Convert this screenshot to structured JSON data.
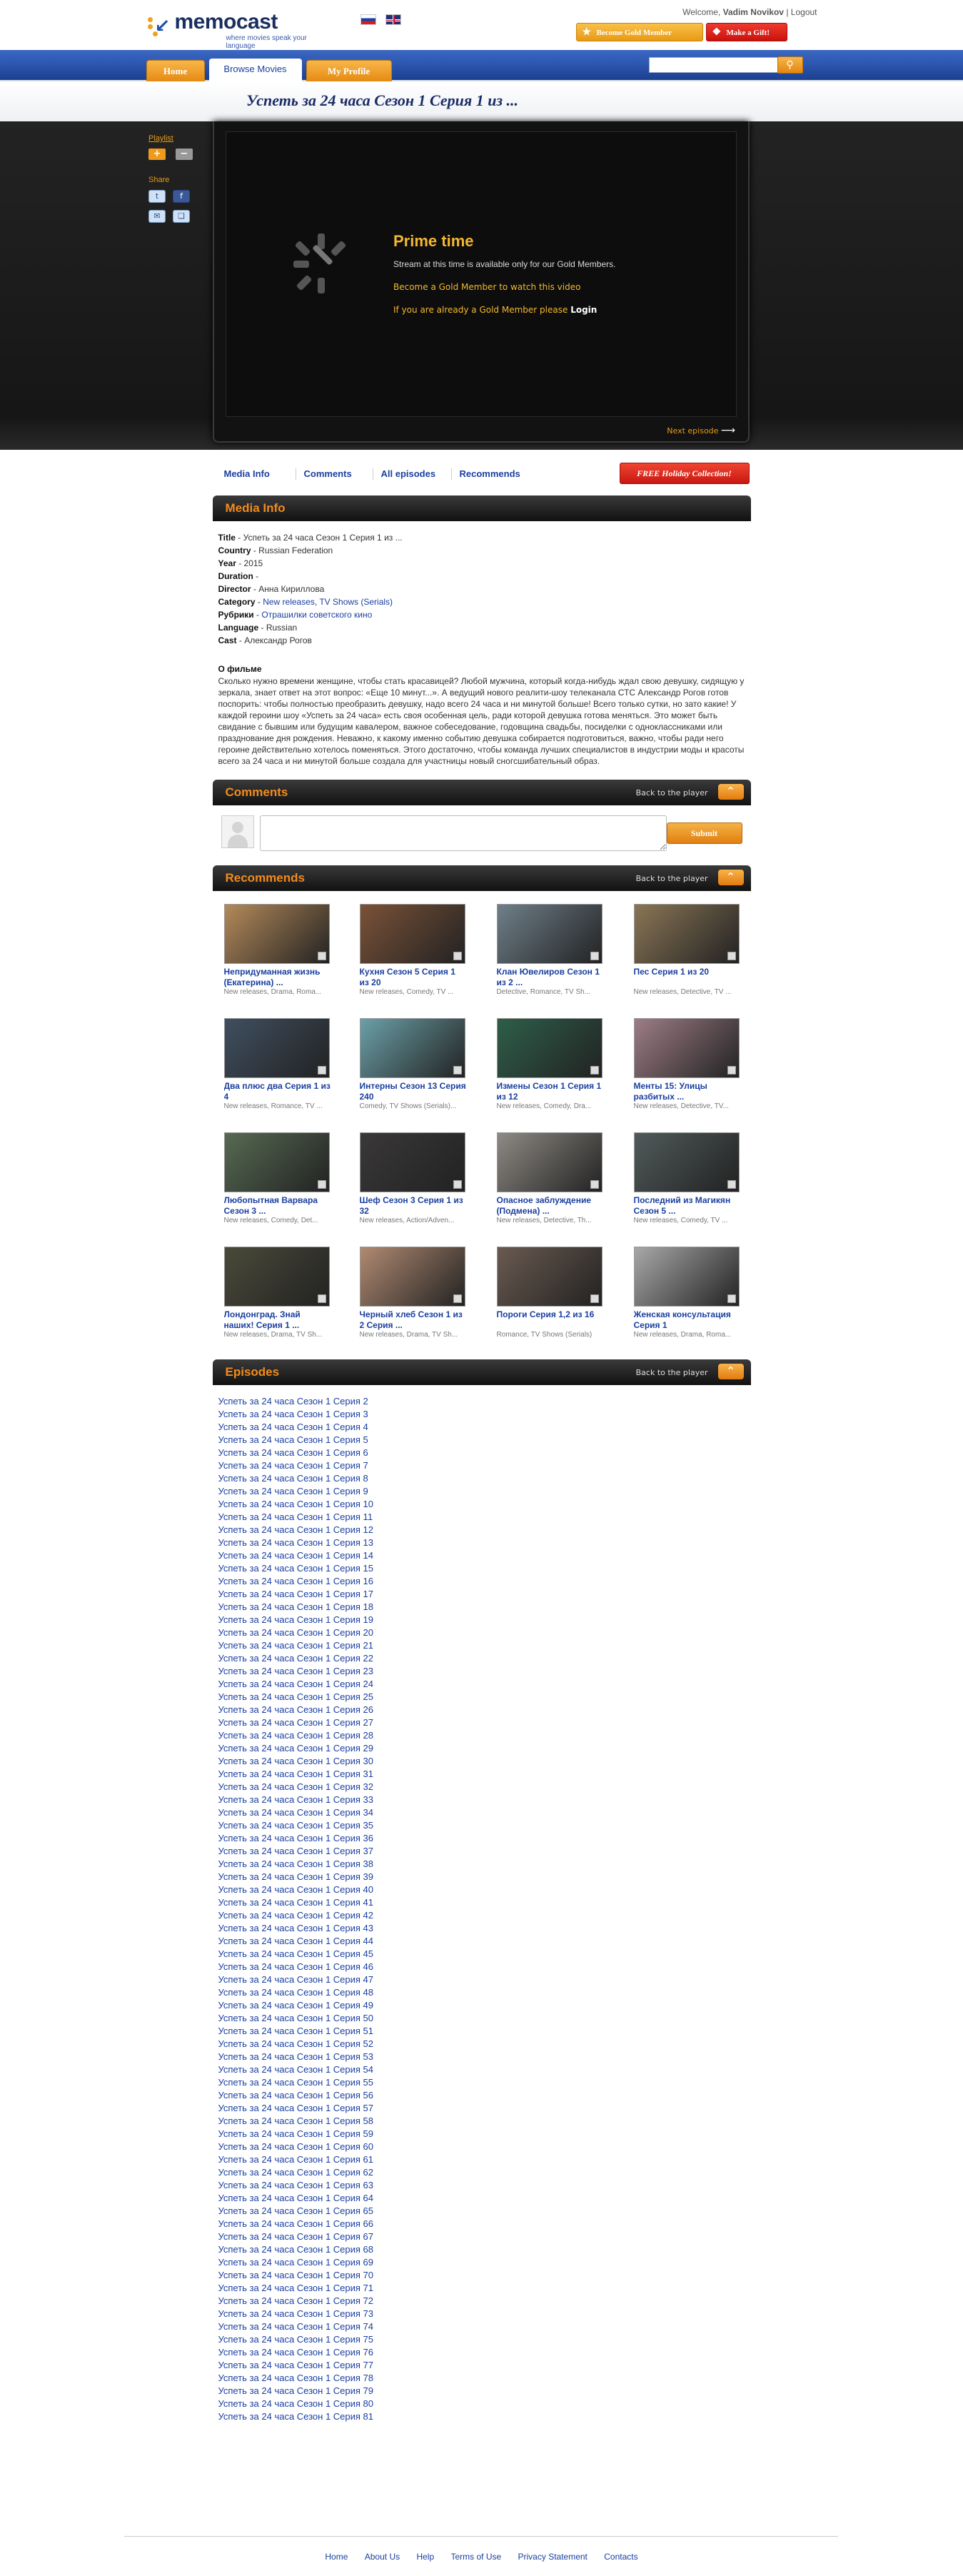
{
  "header": {
    "logo_name": "memocast",
    "logo_tagline": "where movies speak your language",
    "welcome_prefix": "Welcome,",
    "user_name": "Vadim Novikov",
    "logout_label": "Logout",
    "become_gold_label": "Become Gold Member",
    "gift_label": "Make a Gift!"
  },
  "nav": {
    "home": "Home",
    "browse": "Browse Movies",
    "profile": "My Profile",
    "search_placeholder": ""
  },
  "page_title": "Успеть за 24 часа Сезон 1 Серия 1 из ...",
  "side": {
    "playlist": "Playlist",
    "share": "Share"
  },
  "player": {
    "title": "Prime time",
    "desc": "Stream at this time is available only for our Gold Members.",
    "become_gold": "Become a Gold Member to watch this video",
    "if_gold": "If you are already a Gold Member please",
    "login": "Login",
    "next_episode": "Next episode"
  },
  "tabs": {
    "media_info": "Media Info",
    "comments": "Comments",
    "all_episodes": "All episodes",
    "recommends": "Recommends",
    "holiday": "FREE Holiday Collection!"
  },
  "sections": {
    "media_info": "Media Info",
    "comments": "Comments",
    "recommends": "Recommends",
    "episodes": "Episodes",
    "back": "Back to the player",
    "submit": "Submit"
  },
  "media_info": {
    "title_label": "Title",
    "title": "Успеть за 24 часа Сезон 1 Серия 1 из ...",
    "country_label": "Country",
    "country": "Russian Federation",
    "year_label": "Year",
    "year": "2015",
    "duration_label": "Duration",
    "duration": "",
    "director_label": "Director",
    "director": "Анна Кириллова",
    "category_label": "Category",
    "category_1": "New releases",
    "category_2": "TV Shows (Serials)",
    "rubrics_label": "Рубрики",
    "rubrics": "Отрашилки советского кино",
    "language_label": "Language",
    "language": "Russian",
    "cast_label": "Cast",
    "cast": "Александр Рогов",
    "about_heading": "О фильме",
    "about": "Сколько нужно времени женщине, чтобы стать красавицей? Любой мужчина, который когда-нибудь ждал свою девушку, сидящую у зеркала, знает ответ на этот вопрос: «Еще 10 минут...». А ведущий нового реалити-шоу телеканала СТС Александр Рогов готов поспорить: чтобы полностью преобразить девушку, надо всего 24 часа и ни минутой больше! Всего только сутки, но зато какие! У каждой героини шоу «Успеть за 24 часа» есть своя особенная цель, ради которой девушка готова меняться. Это может быть свидание с бывшим или будущим кавалером, важное собеседование, годовщина свадьбы, посиделки с одноклассниками или празднование дня рождения. Неважно, к какому именно событию девушка собирается подготовиться, важно, чтобы ради него героине действительно хотелось поменяться. Этого достаточно, чтобы команда лучших специалистов в индустрии моды и красоты всего за 24 часа и ни минутой больше создала для участницы новый сногсшибательный образ."
  },
  "recommends": [
    {
      "title": "Непридуманная жизнь (Екатерина) ...",
      "genres": "New releases, Drama, Roma...",
      "color": "#b48a5a"
    },
    {
      "title": "Кухня Сезон 5 Серия 1 из 20",
      "genres": "New releases, Comedy, TV ...",
      "color": "#7a5238"
    },
    {
      "title": "Клан Ювелиров Сезон 1 из 2 ...",
      "genres": "Detective, Romance, TV Sh...",
      "color": "#6f7f8a"
    },
    {
      "title": "Пес Серия 1 из 20",
      "genres": "New releases, Detective, TV ...",
      "color": "#8a7656"
    },
    {
      "title": "Два плюс два Серия 1 из 4",
      "genres": "New releases, Romance, TV ...",
      "color": "#3f4f60"
    },
    {
      "title": "Интерны Сезон 13 Серия 240",
      "genres": "Comedy, TV Shows (Serials)...",
      "color": "#6ba0a8"
    },
    {
      "title": "Измены Сезон 1 Серия 1 из 12",
      "genres": "New releases, Comedy, Dra...",
      "color": "#2e5e4a"
    },
    {
      "title": "Менты 15: Улицы разбитых ...",
      "genres": "New releases, Detective, TV...",
      "color": "#9d7d86"
    },
    {
      "title": "Любопытная Варвара Сезон 3 ...",
      "genres": "New releases, Comedy, Det...",
      "color": "#566a52"
    },
    {
      "title": "Шеф Сезон 3 Серия 1 из 32",
      "genres": "New releases, Action/Adven...",
      "color": "#3a3838"
    },
    {
      "title": "Опасное заблуждение (Подмена) ...",
      "genres": "New releases, Detective, Th...",
      "color": "#8e8a84"
    },
    {
      "title": "Последний из Магикян Сезон 5 ...",
      "genres": "New releases, Comedy, TV ...",
      "color": "#505a5a"
    },
    {
      "title": "Лондонград. Знай наших! Серия 1 ...",
      "genres": "New releases, Drama, TV Sh...",
      "color": "#4a4a3a"
    },
    {
      "title": "Черный хлеб Сезон 1 из 2 Серия ...",
      "genres": "New releases, Drama, TV Sh...",
      "color": "#b08a72"
    },
    {
      "title": "Пороги Серия 1,2 из 16",
      "genres": "Romance, TV Shows (Serials)",
      "color": "#6a5a50"
    },
    {
      "title": "Женская консультация Серия 1",
      "genres": "New releases, Drama, Roma...",
      "color": "#a8a8a8"
    }
  ],
  "episodes": [
    "Успеть за 24 часа Сезон 1 Серия 2",
    "Успеть за 24 часа Сезон 1 Серия 3",
    "Успеть за 24 часа Сезон 1 Серия 4",
    "Успеть за 24 часа Сезон 1 Серия 5",
    "Успеть за 24 часа Сезон 1 Серия 6",
    "Успеть за 24 часа Сезон 1 Серия 7",
    "Успеть за 24 часа Сезон 1 Серия 8",
    "Успеть за 24 часа Сезон 1 Серия 9",
    "Успеть за 24 часа Сезон 1 Серия 10",
    "Успеть за 24 часа Сезон 1 Серия 11",
    "Успеть за 24 часа Сезон 1 Серия 12",
    "Успеть за 24 часа Сезон 1 Серия 13",
    "Успеть за 24 часа Сезон 1 Серия 14",
    "Успеть за 24 часа Сезон 1 Серия 15",
    "Успеть за 24 часа Сезон 1 Серия 16",
    "Успеть за 24 часа Сезон 1 Серия 17",
    "Успеть за 24 часа Сезон 1 Серия 18",
    "Успеть за 24 часа Сезон 1 Серия 19",
    "Успеть за 24 часа Сезон 1 Серия 20",
    "Успеть за 24 часа Сезон 1 Серия 21",
    "Успеть за 24 часа Сезон 1 Серия 22",
    "Успеть за 24 часа Сезон 1 Серия 23",
    "Успеть за 24 часа Сезон 1 Серия 24",
    "Успеть за 24 часа Сезон 1 Серия 25",
    "Успеть за 24 часа Сезон 1 Серия 26",
    "Успеть за 24 часа Сезон 1 Серия 27",
    "Успеть за 24 часа Сезон 1 Серия 28",
    "Успеть за 24 часа Сезон 1 Серия 29",
    "Успеть за 24 часа Сезон 1 Серия 30",
    "Успеть за 24 часа Сезон 1 Серия 31",
    "Успеть за 24 часа Сезон 1 Серия 32",
    "Успеть за 24 часа Сезон 1 Серия 33",
    "Успеть за 24 часа Сезон 1 Серия 34",
    "Успеть за 24 часа Сезон 1 Серия 35",
    "Успеть за 24 часа Сезон 1 Серия 36",
    "Успеть за 24 часа Сезон 1 Серия 37",
    "Успеть за 24 часа Сезон 1 Серия 38",
    "Успеть за 24 часа Сезон 1 Серия 39",
    "Успеть за 24 часа Сезон 1 Серия 40",
    "Успеть за 24 часа Сезон 1 Серия 41",
    "Успеть за 24 часа Сезон 1 Серия 42",
    "Успеть за 24 часа Сезон 1 Серия 43",
    "Успеть за 24 часа Сезон 1 Серия 44",
    "Успеть за 24 часа Сезон 1 Серия 45",
    "Успеть за 24 часа Сезон 1 Серия 46",
    "Успеть за 24 часа Сезон 1 Серия 47",
    "Успеть за 24 часа Сезон 1 Серия 48",
    "Успеть за 24 часа Сезон 1 Серия 49",
    "Успеть за 24 часа Сезон 1 Серия 50",
    "Успеть за 24 часа Сезон 1 Серия 51",
    "Успеть за 24 часа Сезон 1 Серия 52",
    "Успеть за 24 часа Сезон 1 Серия 53",
    "Успеть за 24 часа Сезон 1 Серия 54",
    "Успеть за 24 часа Сезон 1 Серия 55",
    "Успеть за 24 часа Сезон 1 Серия 56",
    "Успеть за 24 часа Сезон 1 Серия 57",
    "Успеть за 24 часа Сезон 1 Серия 58",
    "Успеть за 24 часа Сезон 1 Серия 59",
    "Успеть за 24 часа Сезон 1 Серия 60",
    "Успеть за 24 часа Сезон 1 Серия 61",
    "Успеть за 24 часа Сезон 1 Серия 62",
    "Успеть за 24 часа Сезон 1 Серия 63",
    "Успеть за 24 часа Сезон 1 Серия 64",
    "Успеть за 24 часа Сезон 1 Серия 65",
    "Успеть за 24 часа Сезон 1 Серия 66",
    "Успеть за 24 часа Сезон 1 Серия 67",
    "Успеть за 24 часа Сезон 1 Серия 68",
    "Успеть за 24 часа Сезон 1 Серия 69",
    "Успеть за 24 часа Сезон 1 Серия 70",
    "Успеть за 24 часа Сезон 1 Серия 71",
    "Успеть за 24 часа Сезон 1 Серия 72",
    "Успеть за 24 часа Сезон 1 Серия 73",
    "Успеть за 24 часа Сезон 1 Серия 74",
    "Успеть за 24 часа Сезон 1 Серия 75",
    "Успеть за 24 часа Сезон 1 Серия 76",
    "Успеть за 24 часа Сезон 1 Серия 77",
    "Успеть за 24 часа Сезон 1 Серия 78",
    "Успеть за 24 часа Сезон 1 Серия 79",
    "Успеть за 24 часа Сезон 1 Серия 80",
    "Успеть за 24 часа Сезон 1 Серия 81"
  ],
  "footer": {
    "home": "Home",
    "about": "About Us",
    "help": "Help",
    "terms": "Terms of Use",
    "privacy": "Privacy Statement",
    "contacts": "Contacts"
  },
  "colors": {
    "accent_orange": "#f38b1c",
    "nav_blue": "#2d57b0",
    "link_blue": "#1a3f9f"
  }
}
